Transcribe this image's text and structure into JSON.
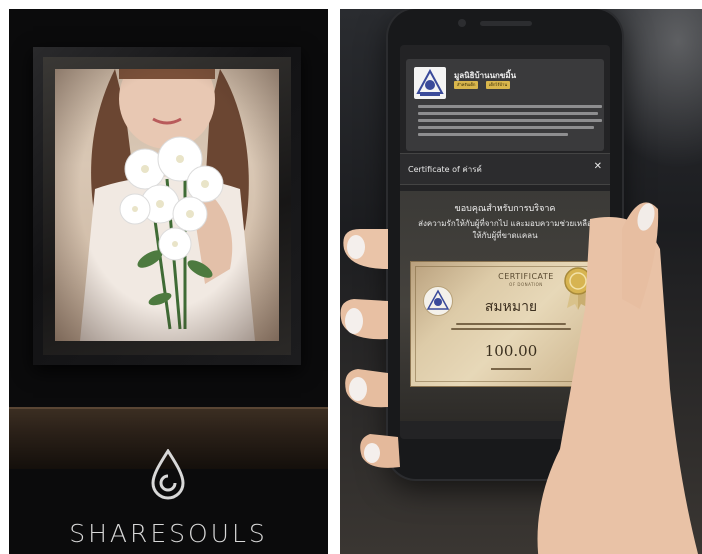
{
  "left": {
    "brand_name": "SHARESOULS"
  },
  "right": {
    "org": {
      "name": "มูลนิธิบ้านนกขมิ้น",
      "tags": [
        "สำหรับเด็ก",
        "เด็กไร้บ้าน"
      ]
    },
    "certificate_panel": {
      "title": "Certificate of ค่ารค์",
      "close_icon": "close-icon",
      "thanks_line1": "ขอบคุณสำหรับการบริจาค",
      "thanks_line2": "ส่งความรักให้กับผู้ที่จากไป และมอบความช่วยเหลือ",
      "thanks_line3": "ให้กับผู้ที่ขาดแคลน"
    },
    "certificate": {
      "heading": "CERTIFICATE",
      "subheading": "OF DONATION",
      "name": "สมหมาย",
      "amount": "100.00"
    }
  },
  "colors": {
    "gold": "#d9b64c",
    "dark_bg": "#0b0b0c"
  }
}
